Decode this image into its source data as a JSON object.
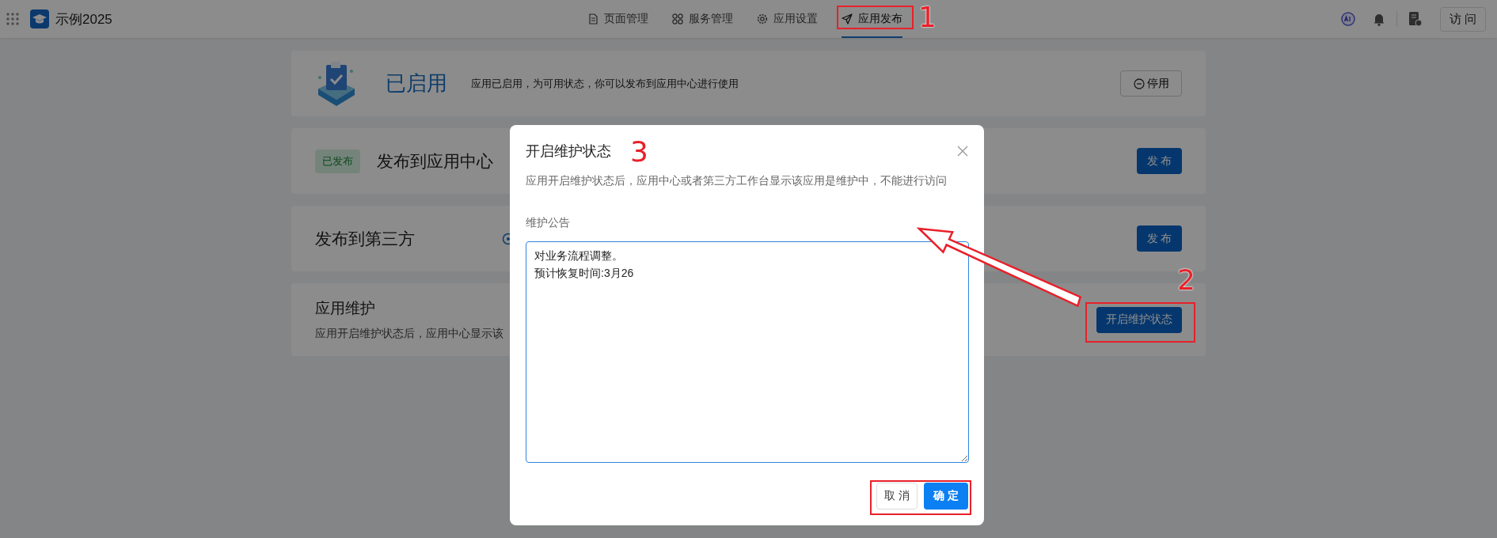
{
  "app": {
    "name": "示例2025"
  },
  "nav": {
    "tabs": [
      {
        "label": "页面管理",
        "selected": false
      },
      {
        "label": "服务管理",
        "selected": false
      },
      {
        "label": "应用设置",
        "selected": false
      },
      {
        "label": "应用发布",
        "selected": true
      }
    ]
  },
  "header_actions": {
    "visit_button": "访 问"
  },
  "cards": [
    {
      "kind": "status",
      "title": "已启用",
      "description": "应用已启用，为可用状态，你可以发布到应用中心进行使用",
      "button": "停用"
    },
    {
      "kind": "publish",
      "badge": "已发布",
      "title": "发布到应用中心",
      "button": "发 布"
    },
    {
      "kind": "third_party",
      "title": "发布到第三方",
      "button": "发 布"
    },
    {
      "kind": "maintenance",
      "title": "应用维护",
      "description": "应用开启维护状态后，应用中心显示该",
      "button": "开启维护状态"
    }
  ],
  "dialog": {
    "title": "开启维护状态",
    "description": "应用开启维护状态后，应用中心或者第三方工作台显示该应用是维护中，不能进行访问",
    "field_label": "维护公告",
    "field_lines": [
      "对业务流程调整。",
      "预计恢复时间:3月26"
    ],
    "buttons": [
      {
        "label": "取 消",
        "kind": "secondary"
      },
      {
        "label": "确 定",
        "kind": "primary"
      }
    ]
  },
  "annotations": [
    {
      "number": "1"
    },
    {
      "number": "2"
    },
    {
      "number": "3"
    }
  ]
}
